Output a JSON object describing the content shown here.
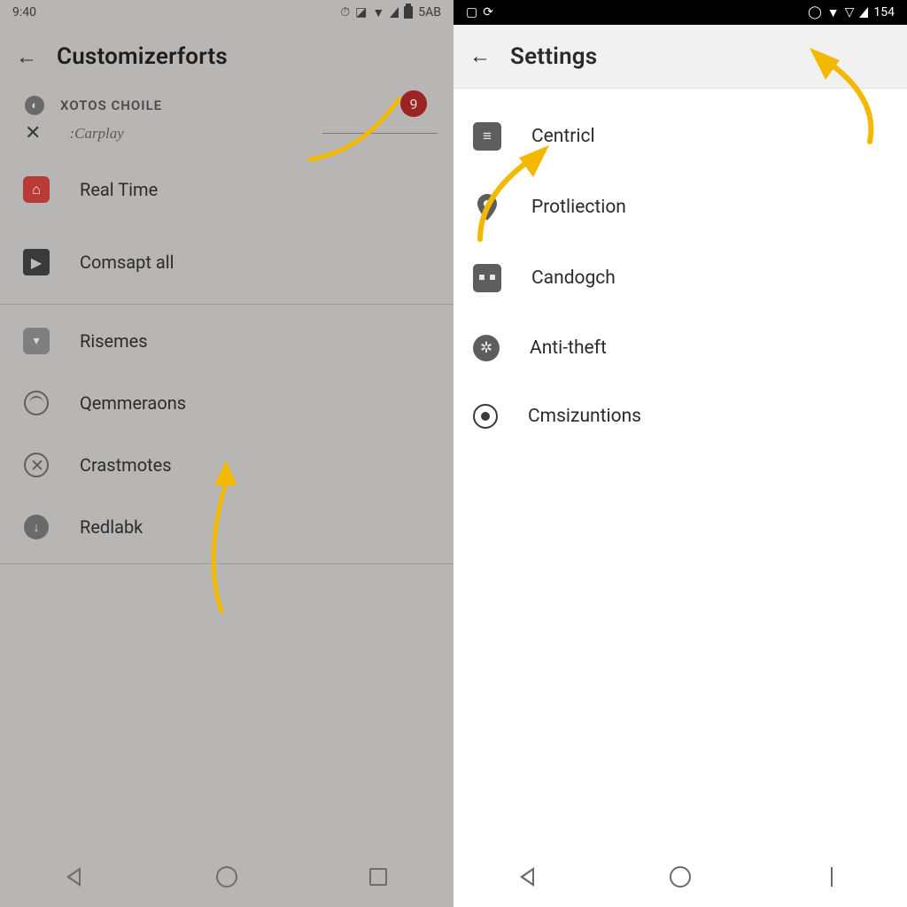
{
  "left": {
    "status": {
      "time": "9:40",
      "battery_label": "5AB"
    },
    "appbar": {
      "title": "Customizerforts"
    },
    "section": {
      "label": "XOTOS  CHOILE",
      "badge": "9"
    },
    "subrow": {
      "label": ":Carplay"
    },
    "items": [
      {
        "label": "Real Time"
      },
      {
        "label": "Comsapt all"
      },
      {
        "label": "Risemes"
      },
      {
        "label": "Qemmeraons"
      },
      {
        "label": "Crastmotes"
      },
      {
        "label": "Redlabk"
      }
    ]
  },
  "right": {
    "status": {
      "battery_label": "154"
    },
    "appbar": {
      "title": "Settings"
    },
    "items": [
      {
        "label": "Centricl"
      },
      {
        "label": "Protliection"
      },
      {
        "label": "Candogch"
      },
      {
        "label": "Anti-theft"
      },
      {
        "label": "Cmsizuntions"
      }
    ]
  }
}
